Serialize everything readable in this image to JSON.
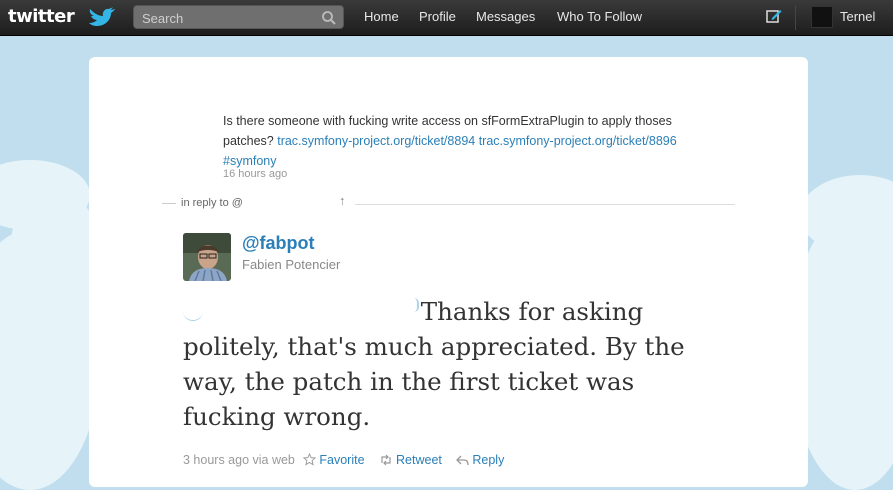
{
  "header": {
    "logo_text": "twitter",
    "search": {
      "placeholder": "Search"
    },
    "nav": [
      "Home",
      "Profile",
      "Messages",
      "Who To Follow"
    ],
    "username": "Ternel"
  },
  "original_tweet": {
    "text_prefix": "Is there someone with fucking write access on sfFormExtraPlugin to apply thoses patches?",
    "link1": "trac.symfony-project.org/ticket/8894",
    "link2": "trac.symfony-project.org/ticket/8896",
    "hashtag": "#symfony",
    "timestamp": "16 hours ago"
  },
  "reply_context": {
    "in_reply_to": "in reply to @",
    "up_arrow": "↑"
  },
  "reply_tweet": {
    "screen_name": "@fabpot",
    "full_name": "Fabien Potencier",
    "text": "Thanks for asking politely, that's much appreciated. By the way, the patch in the first ticket was fucking wrong.",
    "time": "3 hours ago via web",
    "favorite_label": "Favorite",
    "retweet_label": "Retweet",
    "reply_label": "Reply"
  },
  "colors": {
    "link": "#2a7fb8",
    "topbar": "#1d1d1d",
    "sky": "#c0deed"
  }
}
